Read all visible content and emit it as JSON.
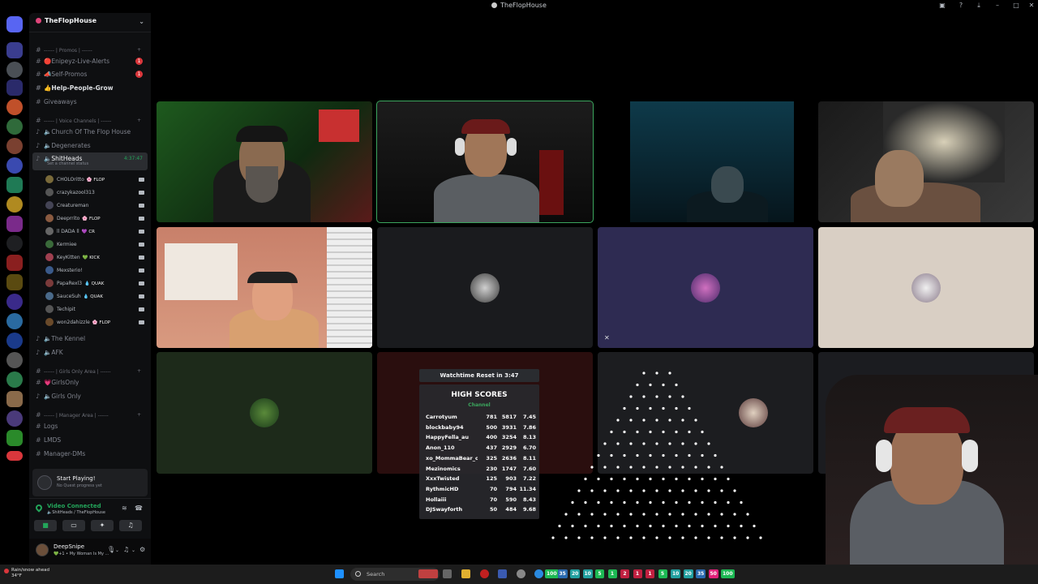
{
  "window": {
    "title": "TheFlopHouse"
  },
  "server": {
    "name": "TheFlopHouse"
  },
  "channels": {
    "cat_promos": "------ | Promos | ------",
    "enipeyz": "🔴Enipeyz-Live-Alerts",
    "self_promo": "📣Self-Promos",
    "help_grow": "👍Help-People-Grow",
    "giveaways": "Giveaways",
    "cat_voice": "------ | Voice Channels | ------",
    "church": "🔈Church Of The Flop House",
    "degenerates": "🔈Degenerates",
    "shitheads": "🔈ShitHeads",
    "shitheads_timer": "4:37:47",
    "shitheads_status": "Set a channel status",
    "kennel": "🔈The Kennel",
    "afk": "🔈AFK",
    "cat_girls": "------ | Girls Only Area | ------",
    "girlsonly_text": "💗GirlsOnly",
    "girlsonly_voice": "🔈Girls Only",
    "cat_manager": "------ | Manager Area | ------",
    "logs": "Logs",
    "lmds": "LMDS",
    "manager_dms": "Manager-DMs",
    "badge1": "1",
    "badge2": "1"
  },
  "members": [
    {
      "name": "CHOLOritto",
      "tag": "🌸 FLOP",
      "color": "#7a6a3a"
    },
    {
      "name": "crazykazool313",
      "tag": "",
      "color": "#555"
    },
    {
      "name": "Creatureman",
      "tag": "",
      "color": "#445"
    },
    {
      "name": "Deeprrito",
      "tag": "🌸 FLOP",
      "color": "#8a5a40"
    },
    {
      "name": "ll DADA ll",
      "tag": "💜 CR",
      "color": "#666"
    },
    {
      "name": "Kermiee",
      "tag": "",
      "color": "#3a6a3a"
    },
    {
      "name": "KeyKitten",
      "tag": "💚 KICK",
      "color": "#a04050"
    },
    {
      "name": "Mexsterio!",
      "tag": "",
      "color": "#3a5a8a"
    },
    {
      "name": "PapaRexl3",
      "tag": "💧 QUAK",
      "color": "#7a3a3a"
    },
    {
      "name": "SauceSuh",
      "tag": "💧 QUAK",
      "color": "#4a6a8a"
    },
    {
      "name": "Techipit",
      "tag": "",
      "color": "#555"
    },
    {
      "name": "won2dahizzle",
      "tag": "🌸 FLOP",
      "color": "#6a4a2a"
    }
  ],
  "activity": {
    "title": "Start Playing!",
    "sub": "No Quest progress yet"
  },
  "voice": {
    "status": "Video Connected",
    "channel": "🔈ShitHeads / TheFlopHouse"
  },
  "user": {
    "name": "DeepSnipe",
    "status": "💚+1 • My Woman Is My ..."
  },
  "overlay": {
    "watchtime": "Watchtime Reset in 3:47",
    "title": "HIGH SCORES",
    "channel": "Channel",
    "rows": [
      [
        "Carrotyum",
        "781",
        "5817",
        "7.45"
      ],
      [
        "blockbaby94",
        "500",
        "3931",
        "7.86"
      ],
      [
        "HappyFella_au",
        "400",
        "3254",
        "8.13"
      ],
      [
        "Anon_110",
        "437",
        "2929",
        "6.70"
      ],
      [
        "xo_MommaBear_ox",
        "325",
        "2636",
        "8.11"
      ],
      [
        "Mezinomics",
        "230",
        "1747",
        "7.60"
      ],
      [
        "XxxTwisted",
        "125",
        "903",
        "7.22"
      ],
      [
        "RythmicHD",
        "70",
        "794",
        "11.34"
      ],
      [
        "Hollaiii",
        "70",
        "590",
        "8.43"
      ],
      [
        "DJSwayforth",
        "50",
        "484",
        "9.68"
      ]
    ]
  },
  "taskbar": {
    "weather": "Rain/snow ahead",
    "weather_temp": "34°F",
    "search": "Search",
    "chips": [
      "100",
      "35",
      "20",
      "10",
      "5",
      "1",
      "2",
      "1",
      "1",
      "5",
      "10",
      "20",
      "35",
      "50",
      "100"
    ]
  },
  "colors": {
    "accent_green": "#3ba55d",
    "sidebar_bg": "#0e0f11",
    "unread_red": "#da373c"
  }
}
